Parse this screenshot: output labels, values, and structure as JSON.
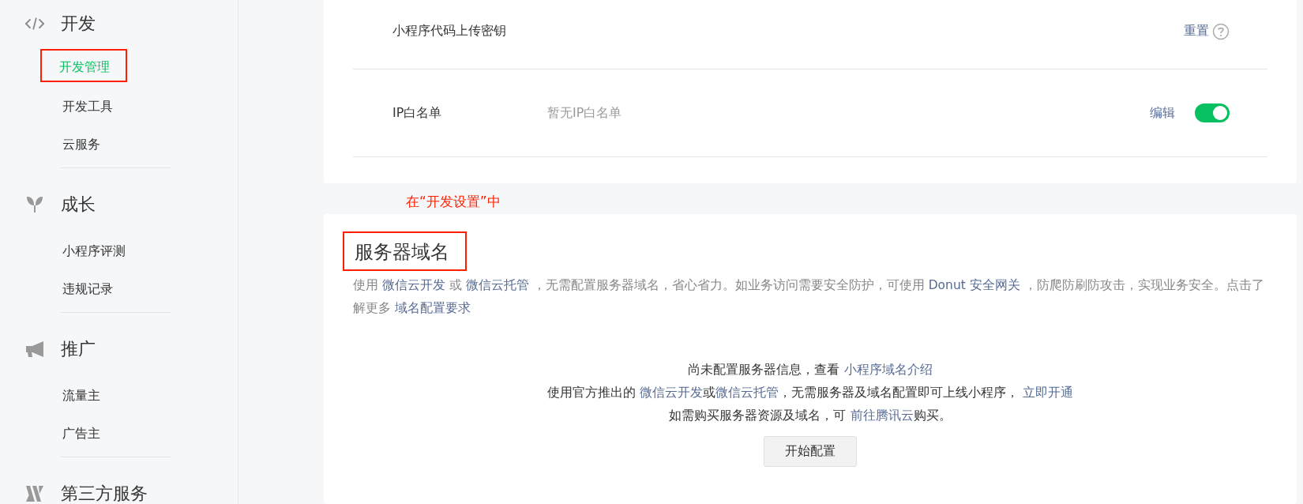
{
  "sidebar": {
    "groups": [
      {
        "title": "开发",
        "items": [
          {
            "label": "开发管理",
            "selected": true,
            "annotated": true
          },
          {
            "label": "开发工具",
            "selected": false,
            "annotated": false
          },
          {
            "label": "云服务",
            "selected": false,
            "annotated": false
          }
        ]
      },
      {
        "title": "成长",
        "items": [
          {
            "label": "小程序评测",
            "selected": false,
            "annotated": false
          },
          {
            "label": "违规记录",
            "selected": false,
            "annotated": false
          }
        ]
      },
      {
        "title": "推广",
        "items": [
          {
            "label": "流量主",
            "selected": false,
            "annotated": false
          },
          {
            "label": "广告主",
            "selected": false,
            "annotated": false
          }
        ]
      },
      {
        "title": "第三方服务"
      }
    ]
  },
  "settings_card": {
    "rows": [
      {
        "label": "小程序代码上传密钥",
        "action": "重置",
        "help": true
      },
      {
        "label": "IP白名单",
        "value": "暂无IP白名单",
        "action": "编辑",
        "toggle": {
          "on": true
        }
      }
    ]
  },
  "annotation": "在“开发设置”中",
  "server_domain": {
    "title": "服务器域名",
    "title_annotated": true,
    "description": [
      {
        "text": "使用 ",
        "link": false
      },
      {
        "text": "微信云开发",
        "link": true
      },
      {
        "text": " 或 ",
        "link": false
      },
      {
        "text": "微信云托管",
        "link": true
      },
      {
        "text": " ，无需配置服务器域名，省心省力。如业务访问需要安全防护，可使用 ",
        "link": false
      },
      {
        "text": "Donut 安全网关",
        "link": true
      },
      {
        "text": " ，防爬防刷防攻击，实现业务安全。点击了解更多 ",
        "link": false
      },
      {
        "text": "域名配置要求",
        "link": true
      }
    ],
    "empty_lines": [
      [
        {
          "text": "尚未配置服务器信息，查看 ",
          "link": false
        },
        {
          "text": "小程序域名介绍",
          "link": true
        }
      ],
      [
        {
          "text": "使用官方推出的 ",
          "link": false
        },
        {
          "text": "微信云开发",
          "link": true
        },
        {
          "text": "或",
          "link": false
        },
        {
          "text": "微信云托管",
          "link": true
        },
        {
          "text": "，无需服务器及域名配置即可上线小程序， ",
          "link": false
        },
        {
          "text": "立即开通",
          "link": true
        }
      ],
      [
        {
          "text": "如需购买服务器资源及域名，可 ",
          "link": false
        },
        {
          "text": "前往腾讯云",
          "link": true
        },
        {
          "text": "购买。",
          "link": false
        }
      ]
    ],
    "button": "开始配置"
  }
}
